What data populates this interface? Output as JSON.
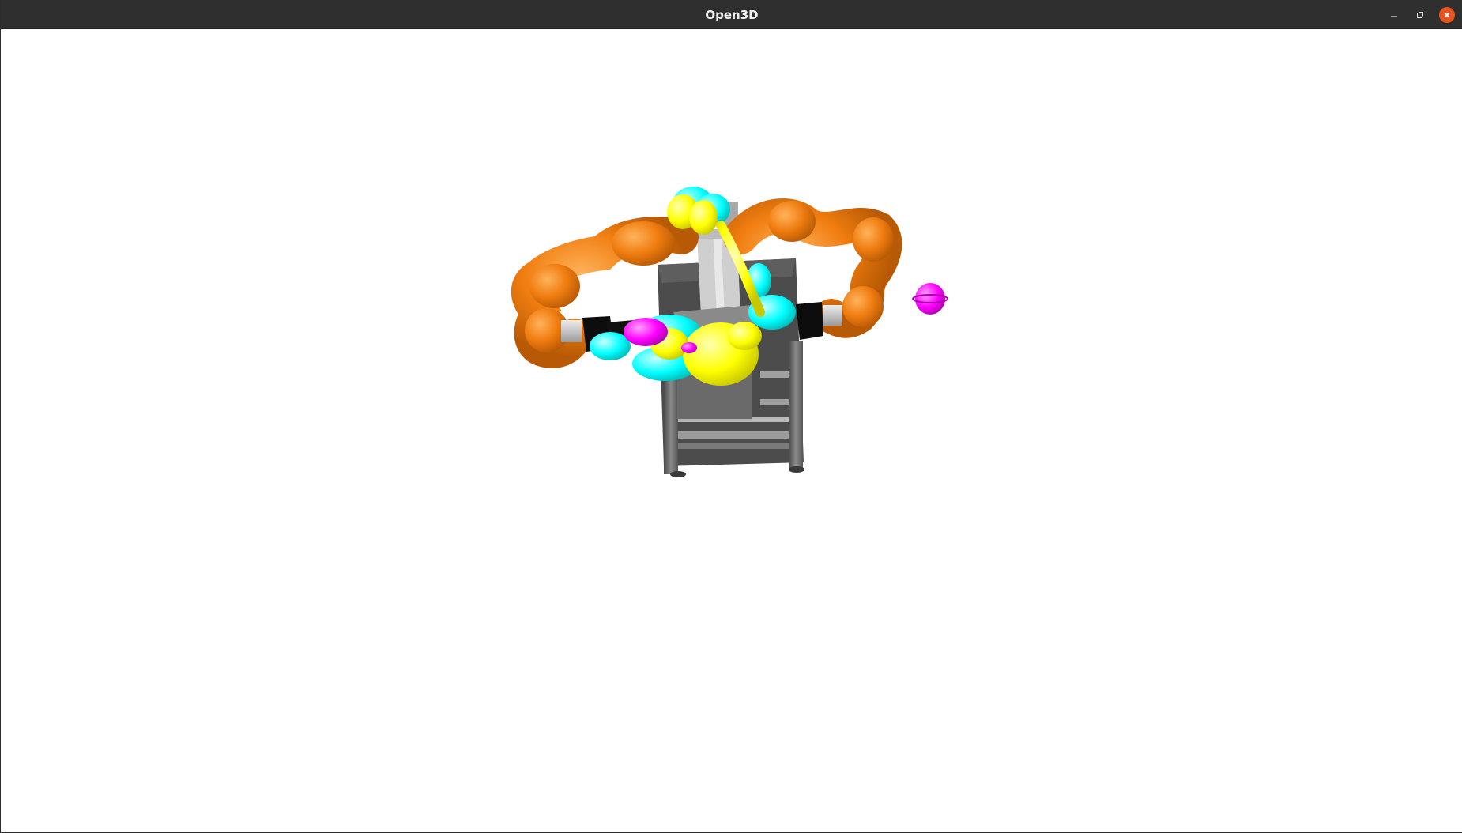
{
  "window": {
    "title": "Open3D",
    "controls": {
      "minimize_icon": "minimize-icon",
      "maximize_icon": "restore-icon",
      "close_icon": "close-icon"
    }
  },
  "viewport": {
    "background": "#ffffff",
    "scene_objects": [
      {
        "name": "work-table",
        "color": "#6e6e6e"
      },
      {
        "name": "left-robot-arm",
        "color": "#f07d10"
      },
      {
        "name": "right-robot-arm",
        "color": "#f07d10"
      },
      {
        "name": "collision-spheres-cyan",
        "color": "#00ffff"
      },
      {
        "name": "collision-spheres-yellow",
        "color": "#ffff00"
      },
      {
        "name": "target-sphere-magenta",
        "color": "#ff00ff"
      },
      {
        "name": "grippers",
        "color": "#0a0a0a"
      }
    ]
  }
}
